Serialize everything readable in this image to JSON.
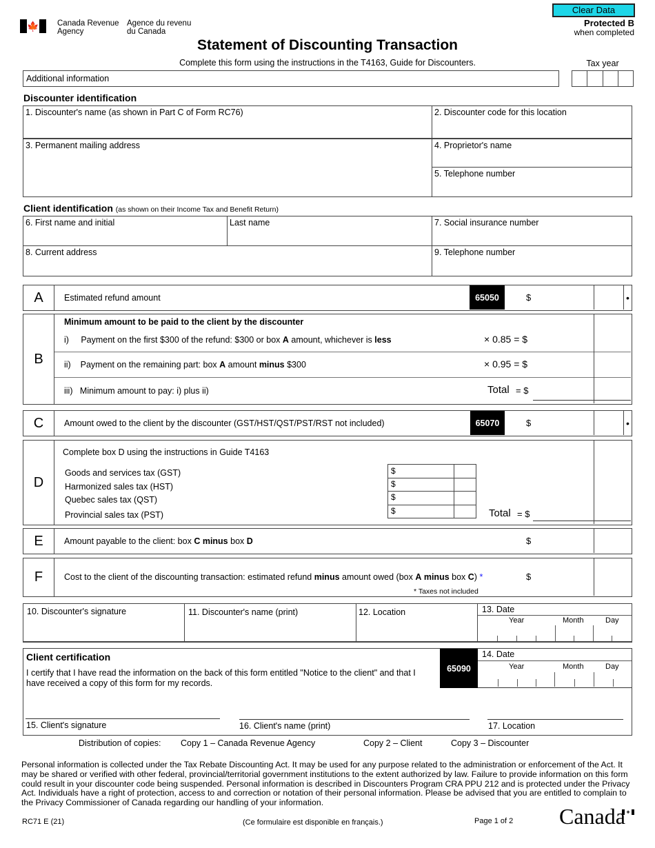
{
  "header": {
    "agency_en_line1": "Canada Revenue",
    "agency_en_line2": "Agency",
    "agency_fr_line1": "Agence du revenu",
    "agency_fr_line2": "du Canada",
    "clear_button": "Clear Data",
    "protected": "Protected B",
    "when_completed": "when completed",
    "title": "Statement of Discounting Transaction",
    "subtitle": "Complete this form using the instructions in the T4163, Guide for Discounters.",
    "tax_year_label": "Tax year",
    "additional_info_placeholder": "Additional information",
    "flag_icon": "canada-flag-icon"
  },
  "discounter": {
    "title": "Discounter identification",
    "field1": "1. Discounter's name (as shown in Part C of Form RC76)",
    "field2": "2. Discounter code for this location",
    "field3": "3. Permanent mailing address",
    "field4": "4. Proprietor's name",
    "field5": "5. Telephone number"
  },
  "client": {
    "title": "Client identification",
    "subtitle": "(as shown on their Income Tax and Benefit Return)",
    "field6": "6. First name and initial",
    "last_name": "Last name",
    "field7": "7. Social insurance number",
    "field8": "8. Current address",
    "field9": "9. Telephone number"
  },
  "boxes": {
    "A": {
      "letter": "A",
      "label": "Estimated refund amount",
      "code": "65050",
      "dollar": "$",
      "dot": "•"
    },
    "B": {
      "letter": "B",
      "heading": "Minimum amount to be paid to the client by the discounter",
      "i_num": "i)",
      "i_pre": "Payment on the first $300 of the refund: $300 or box ",
      "i_bold1": "A",
      "i_mid": " amount, whichever is ",
      "i_bold2": "less",
      "i_calc": "× 0.85 = $",
      "ii_num": "ii)",
      "ii_pre": "Payment on the remaining part: box ",
      "ii_bold1": "A",
      "ii_mid": " amount ",
      "ii_bold2": "minus",
      "ii_post": " $300",
      "ii_calc": "× 0.95 = $",
      "iii_num": "iii)",
      "iii_label": "Minimum amount to pay: i) plus ii)",
      "iii_total": "Total",
      "iii_eq": "= $"
    },
    "C": {
      "letter": "C",
      "label": "Amount owed to the client by the discounter (GST/HST/QST/PST/RST not included)",
      "code": "65070",
      "dollar": "$",
      "dot": "•"
    },
    "D": {
      "letter": "D",
      "instruction": "Complete box D using the instructions in Guide T4163",
      "taxes": [
        {
          "label": "Goods and services tax (GST)",
          "dollar": "$"
        },
        {
          "label": "Harmonized sales tax (HST)",
          "dollar": "$"
        },
        {
          "label": "Quebec sales tax (QST)",
          "dollar": "$"
        },
        {
          "label": "Provincial sales tax (PST)",
          "dollar": "$"
        }
      ],
      "total": "Total",
      "eq": "= $"
    },
    "E": {
      "letter": "E",
      "pre": "Amount payable to the client: box ",
      "b1": "C",
      "sp": " ",
      "b2": "minus",
      "mid": " box ",
      "b3": "D",
      "dollar": "$"
    },
    "F": {
      "letter": "F",
      "pre": "Cost to the client of the discounting transaction: estimated refund ",
      "b1": "minus",
      "mid": " amount owed (box ",
      "b2": "A",
      "sp": " ",
      "b3": "minus",
      "mid2": " box ",
      "b4": "C",
      "post": ")",
      "star": " *",
      "note": "* Taxes not included",
      "dollar": "$"
    }
  },
  "signatures": {
    "field10": "10. Discounter's signature",
    "field11": "11. Discounter's name (print)",
    "field12": "12. Location",
    "field13": "13. Date",
    "year": "Year",
    "month": "Month",
    "day": "Day"
  },
  "certification": {
    "title": "Client certification",
    "text": "I certify that I have read the information on the back of this form entitled \"Notice to the client\" and that I have received a copy of this form for my records.",
    "code": "65090",
    "field14": "14. Date",
    "year": "Year",
    "month": "Month",
    "day": "Day",
    "field15": "15. Client's signature",
    "field16": "16. Client's name (print)",
    "field17": "17. Location"
  },
  "distribution": {
    "label": "Distribution of copies:",
    "copy1": "Copy 1 – Canada Revenue Agency",
    "copy2": "Copy 2 – Client",
    "copy3": "Copy 3 – Discounter"
  },
  "footer": {
    "privacy": "Personal information is collected under the Tax Rebate Discounting Act. It may be used for any purpose related to the administration or enforcement of the Act. It may be shared or verified with other federal, provincial/territorial government institutions to the extent authorized by law. Failure to provide information on this form could result in your discounter code being suspended. Personal information is described in Discounters Program CRA PPU 212 and is protected under the Privacy Act. Individuals have a right of protection, access to and correction or notation of their personal information. Please be advised that you are entitled to complain to the Privacy Commissioner of Canada regarding our handling of your information.",
    "form_id": "RC71 E (21)",
    "french": "(Ce formulaire est disponible en français.)",
    "page": "Page 1 of 2",
    "wordmark": "Canada"
  }
}
